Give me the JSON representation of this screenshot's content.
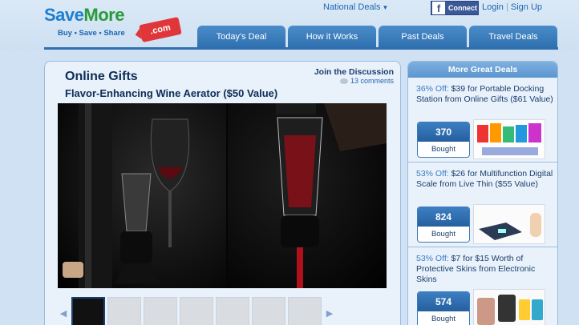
{
  "header": {
    "logo": {
      "part1": "Save",
      "part2": "More",
      "tagline": "Buy • Save • Share",
      "badge": ".com"
    },
    "region_label": "National Deals",
    "facebook_label": "Connect",
    "login_label": "Login",
    "signup_label": "Sign Up",
    "separator": "|"
  },
  "nav": {
    "tabs": [
      "Today's Deal",
      "How it Works",
      "Past Deals",
      "Travel Deals"
    ]
  },
  "deal": {
    "category": "Online Gifts",
    "title": "Flavor-Enhancing Wine Aerator ($50 Value)",
    "discussion_label": "Join the Discussion",
    "comments_label": "13 comments"
  },
  "rail": {
    "title": "More Great Deals",
    "items": [
      {
        "off": "36% Off:",
        "text": "$39 for Portable Docking Station from Online Gifts ($61 Value)",
        "count": "370",
        "bought": "Bought"
      },
      {
        "off": "53% Off:",
        "text": "$26 for Multifunction Digital Scale from Live Thin ($55 Value)",
        "count": "824",
        "bought": "Bought"
      },
      {
        "off": "53% Off:",
        "text": "$7 for $15 Worth of Protective Skins from Electronic Skins",
        "count": "574",
        "bought": "Bought"
      }
    ]
  },
  "colors": {
    "accent": "#2f6faf",
    "brand_blue": "#1e7fd0",
    "brand_green": "#2a9a3a",
    "badge_red": "#e0363a"
  }
}
